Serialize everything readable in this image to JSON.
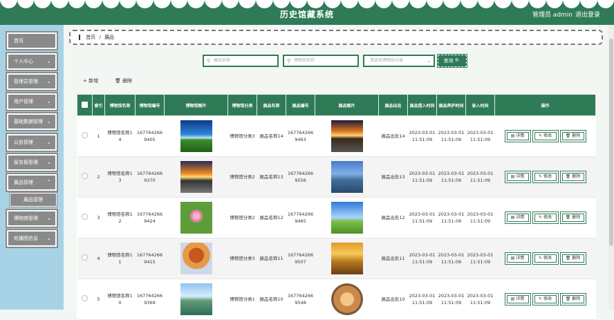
{
  "header": {
    "title": "历史馆藏系统",
    "user": "管理员 admin",
    "logout": "退出登录"
  },
  "sidebar": {
    "items": [
      {
        "label": "首页",
        "chev": ""
      },
      {
        "label": "个人中心",
        "chev": "⌄"
      },
      {
        "label": "管理员管理",
        "chev": "⌄"
      },
      {
        "label": "用户管理",
        "chev": "⌄"
      },
      {
        "label": "基础数据管理",
        "chev": "⌄"
      },
      {
        "label": "公告管理",
        "chev": "⌄"
      },
      {
        "label": "留言板管理",
        "chev": "⌄"
      },
      {
        "label": "展品管理",
        "chev": "⌃"
      },
      {
        "label": "博物馆管理",
        "chev": "⌄"
      },
      {
        "label": "轮播图信息",
        "chev": "⌄"
      }
    ],
    "sub_item": "展品管理"
  },
  "breadcrumb": {
    "home": "首页",
    "sep": "/",
    "current": "展品"
  },
  "search": {
    "exhibit_name_placeholder": "展品名称",
    "museum_name_placeholder": "博物馆名称",
    "category_placeholder": "请选择博物馆分类",
    "query_label": "查询 🔍"
  },
  "actions": {
    "add": "+ 新增",
    "delete": "🗑 删除"
  },
  "table": {
    "headers": [
      "",
      "索引",
      "博物馆名称",
      "博物馆编号",
      "博物馆图片",
      "博物馆分类",
      "展品名称",
      "展品编号",
      "展品图片",
      "展品出处",
      "展品借入时间",
      "展品养护时间",
      "录入时间",
      "操作"
    ],
    "op_labels": {
      "detail": "▤ 详情",
      "edit": "✎ 修改",
      "delete": "🗑 删除"
    },
    "rows": [
      {
        "idx": "1",
        "museum": "博物馆名称14",
        "museum_no": "1677642669405",
        "category": "博物馆分类3",
        "exhibit": "展品名称14",
        "exhibit_no": "1677642669463",
        "origin": "展品出处14",
        "borrow": "2023-03-01 11:51:09",
        "care": "2023-03-01 11:51:09",
        "entry": "2023-03-01 11:51:09"
      },
      {
        "idx": "2",
        "museum": "博物馆名称13",
        "museum_no": "1677642669370",
        "category": "博物馆分类2",
        "exhibit": "展品名称13",
        "exhibit_no": "1677642669556",
        "origin": "展品出处13",
        "borrow": "2023-03-01 11:51:09",
        "care": "2023-03-01 11:51:09",
        "entry": "2023-03-01 11:51:09"
      },
      {
        "idx": "3",
        "museum": "博物馆名称12",
        "museum_no": "1677642669424",
        "category": "博物馆分类2",
        "exhibit": "展品名称12",
        "exhibit_no": "1677642669465",
        "origin": "展品出处12",
        "borrow": "2023-03-01 11:51:09",
        "care": "2023-03-01 11:51:09",
        "entry": "2023-03-01 11:51:09"
      },
      {
        "idx": "4",
        "museum": "博物馆名称11",
        "museum_no": "1677642669415",
        "category": "博物馆分类3",
        "exhibit": "展品名称11",
        "exhibit_no": "1677642669507",
        "origin": "展品出处11",
        "borrow": "2023-03-01 11:51:09",
        "care": "2023-03-01 11:51:09",
        "entry": "2023-03-01 11:51:09"
      },
      {
        "idx": "5",
        "museum": "博物馆名称10",
        "museum_no": "1677642669369",
        "category": "博物馆分类1",
        "exhibit": "展品名称10",
        "exhibit_no": "1677642669548",
        "origin": "展品出处10",
        "borrow": "2023-03-01 11:51:09",
        "care": "2023-03-01 11:51:09",
        "entry": "2023-03-01 11:51:09"
      }
    ]
  }
}
